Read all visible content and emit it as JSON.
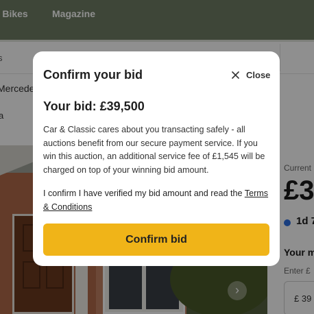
{
  "nav": {
    "classic_bikes": "sic Bikes",
    "magazine": "Magazine"
  },
  "page": {
    "crumb_fragment": "s",
    "title_fragment": "Mercede",
    "subtitle_fragment": "a",
    "current_label": "Current",
    "current_price": "£3",
    "time_left": "1d 7",
    "your_max_label": "Your m",
    "enter_hint": "Enter £",
    "bid_input_value": "£ 39"
  },
  "modal": {
    "title": "Confirm your bid",
    "close_label": "Close",
    "bid_heading": "Your bid: £39,500",
    "info_text": "Car & Classic cares about you transacting safely - all auctions benefit from our secure payment service. If you win this auction, an additional service fee of £1,545 will be charged on top of your winning bid amount.",
    "confirm_statement": "I confirm I have verified my bid amount and read the ",
    "terms_link": "Terms & Conditions",
    "confirm_button": "Confirm bid"
  },
  "colors": {
    "nav_green": "#6f7e64",
    "accent_yellow": "#f0b418",
    "timer_dot": "#2d6fe0"
  },
  "icons": {
    "close": "close-icon",
    "carousel_next": "chevron-right-icon"
  }
}
